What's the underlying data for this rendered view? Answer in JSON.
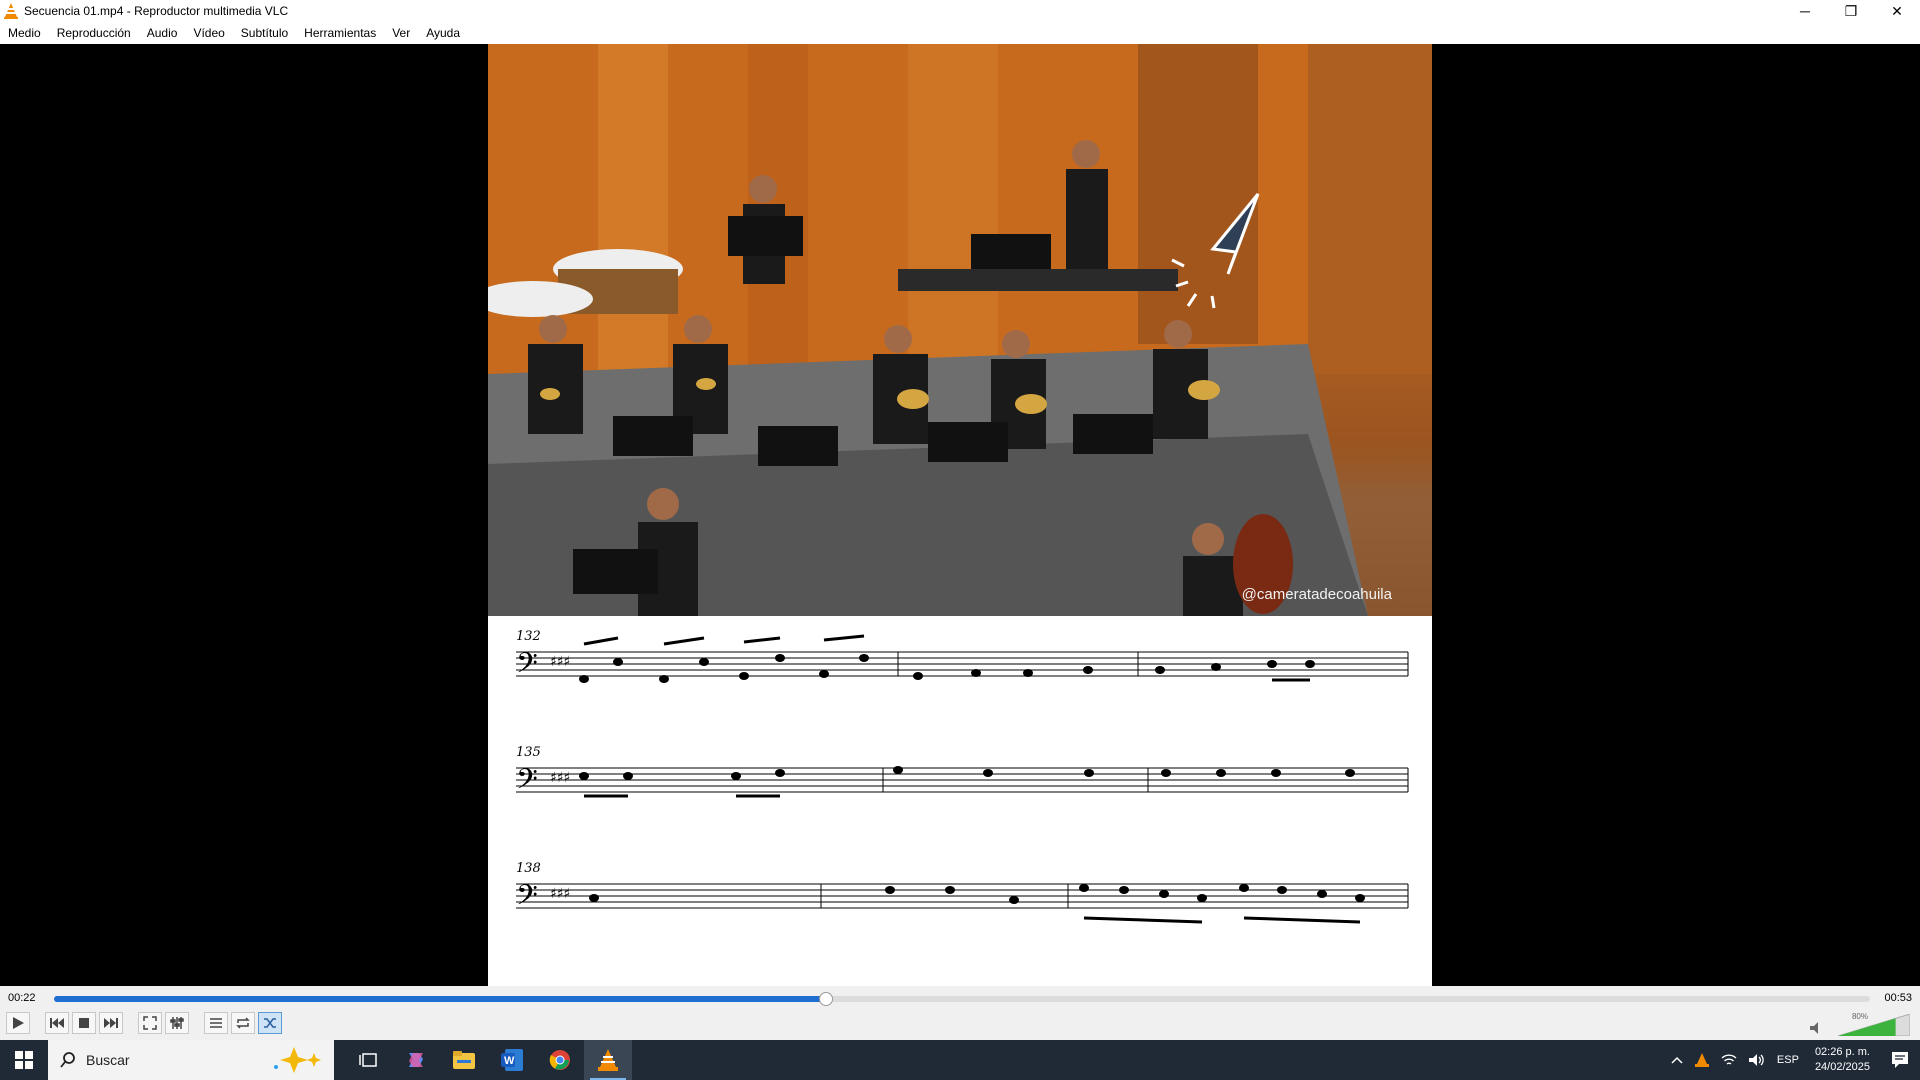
{
  "window": {
    "title": "Secuencia 01.mp4 - Reproductor multimedia VLC",
    "minimize": "─",
    "restore": "❐",
    "close": "✕"
  },
  "menu": [
    "Medio",
    "Reproducción",
    "Audio",
    "Vídeo",
    "Subtítulo",
    "Herramientas",
    "Ver",
    "Ayuda"
  ],
  "video": {
    "watermark": "@cameratadecoahuila",
    "sheet_music_measures": [
      "132",
      "135",
      "138"
    ]
  },
  "player": {
    "current_time": "00:22",
    "total_time": "00:53",
    "progress": 0.425,
    "volume_label": "80%",
    "volume": 0.8
  },
  "taskbar": {
    "search_placeholder": "Buscar",
    "language": "ESP",
    "time": "02:26 p. m.",
    "date": "24/02/2025"
  },
  "colors": {
    "seek_fill": "#1e6fd1",
    "taskbar_bg": "#1f2a36",
    "vlc_orange": "#f08a00"
  }
}
